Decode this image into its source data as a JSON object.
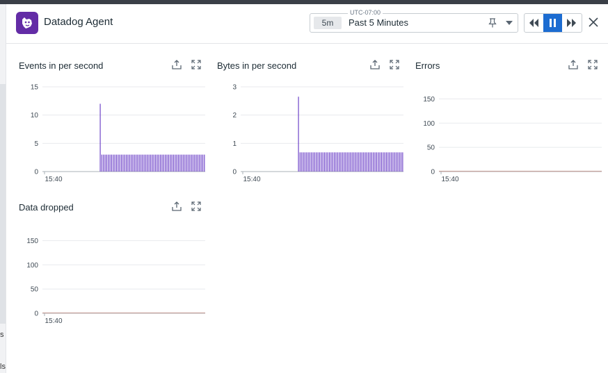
{
  "app": {
    "title": "Datadog Agent",
    "logo_icon": "datadog-dog-icon",
    "brand_color": "#632ca6"
  },
  "time_picker": {
    "timezone": "UTC-07:00",
    "short_label": "5m",
    "label": "Past 5 Minutes",
    "pin_icon": "pin-icon",
    "dropdown_icon": "chevron-down-icon"
  },
  "playback": {
    "rewind_icon": "rewind-icon",
    "pause_icon": "pause-icon",
    "forward_icon": "fast-forward-icon",
    "active": "pause",
    "active_color": "#1c6cd1"
  },
  "close_icon": "close-icon",
  "panel_icons": {
    "export": "export-icon",
    "expand": "expand-icon"
  },
  "panels": [
    {
      "title": "Events in per second"
    },
    {
      "title": "Bytes in per second"
    },
    {
      "title": "Errors"
    },
    {
      "title": "Data dropped"
    }
  ],
  "left_edge_fragments": [
    "s",
    "ls"
  ],
  "chart_data": [
    {
      "type": "bar",
      "x_tick_labels": [
        "15:40"
      ],
      "y_ticks": [
        0,
        5,
        10,
        15
      ],
      "ylim": [
        0,
        15
      ],
      "grid": true,
      "color": "#6b3fc7",
      "series": [
        {
          "values": [
            0,
            0,
            0,
            0,
            0,
            0,
            0,
            0,
            0,
            0,
            0,
            0,
            0,
            0,
            0,
            0,
            0,
            0,
            0,
            0,
            0,
            0,
            0,
            0,
            0,
            0,
            0,
            0,
            0,
            0,
            0,
            0,
            0,
            0,
            0,
            12,
            3,
            3,
            3,
            3,
            3,
            3,
            3,
            3,
            3,
            3,
            3,
            3,
            3,
            3,
            3,
            3,
            3,
            3,
            3,
            3,
            3,
            3,
            3,
            3,
            3,
            3,
            3,
            3,
            3,
            3,
            3,
            3,
            3,
            3,
            3,
            3,
            3,
            3,
            3,
            3,
            3,
            3,
            3,
            3,
            3,
            3,
            3,
            3,
            3,
            3,
            3,
            3,
            3,
            3,
            3,
            3,
            3,
            3,
            3,
            3,
            3,
            3,
            3,
            3
          ]
        }
      ]
    },
    {
      "type": "bar",
      "x_tick_labels": [
        "15:40"
      ],
      "y_ticks": [
        0,
        1,
        2,
        3
      ],
      "ylim": [
        0,
        3
      ],
      "grid": true,
      "color": "#6b3fc7",
      "series": [
        {
          "values": [
            0,
            0,
            0,
            0,
            0,
            0,
            0,
            0,
            0,
            0,
            0,
            0,
            0,
            0,
            0,
            0,
            0,
            0,
            0,
            0,
            0,
            0,
            0,
            0,
            0,
            0,
            0,
            0,
            0,
            0,
            0,
            0,
            0,
            0,
            0,
            2.65,
            0.68,
            0.68,
            0.68,
            0.68,
            0.68,
            0.68,
            0.68,
            0.68,
            0.68,
            0.68,
            0.68,
            0.68,
            0.68,
            0.68,
            0.68,
            0.68,
            0.68,
            0.68,
            0.68,
            0.68,
            0.68,
            0.68,
            0.68,
            0.68,
            0.68,
            0.68,
            0.68,
            0.68,
            0.68,
            0.68,
            0.68,
            0.68,
            0.68,
            0.68,
            0.68,
            0.68,
            0.68,
            0.68,
            0.68,
            0.68,
            0.68,
            0.68,
            0.68,
            0.68,
            0.68,
            0.68,
            0.68,
            0.68,
            0.68,
            0.68,
            0.68,
            0.68,
            0.68,
            0.68,
            0.68,
            0.68,
            0.68,
            0.68,
            0.68,
            0.68,
            0.68,
            0.68,
            0.68,
            0.68
          ]
        }
      ]
    },
    {
      "type": "line",
      "x_tick_labels": [
        "15:40"
      ],
      "y_ticks": [
        0,
        50,
        100,
        150
      ],
      "ylim": [
        0,
        175
      ],
      "grid": true,
      "color": "#c9a59e",
      "series": [
        {
          "values": [
            0,
            0
          ]
        }
      ]
    },
    {
      "type": "line",
      "x_tick_labels": [
        "15:40"
      ],
      "y_ticks": [
        0,
        50,
        100,
        150
      ],
      "ylim": [
        0,
        175
      ],
      "grid": true,
      "color": "#c9a59e",
      "series": [
        {
          "values": [
            0,
            0
          ]
        }
      ]
    }
  ]
}
